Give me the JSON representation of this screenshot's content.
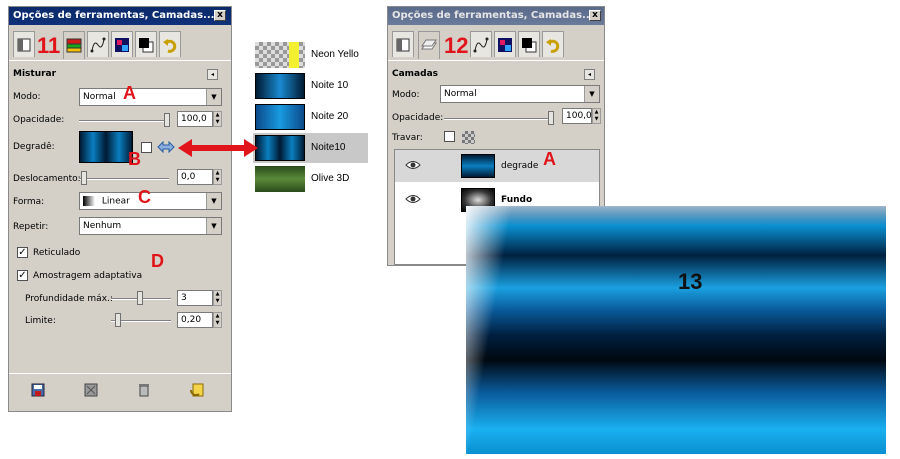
{
  "left_panel": {
    "title": "Opções de ferramentas, Camadas...",
    "close": "x",
    "tab_badge": "11",
    "section_title": "Misturar",
    "mode_label": "Modo:",
    "mode_value": "Normal",
    "opacity_label": "Opacidade:",
    "opacity_value": "100,0",
    "gradient_label": "Degradê:",
    "offset_label": "Deslocamento:",
    "offset_value": "0,0",
    "shape_label": "Forma:",
    "shape_value": "Linear",
    "repeat_label": "Repetir:",
    "repeat_value": "Nenhum",
    "dither_label": "Reticulado",
    "adaptive_label": "Amostragem adaptativa",
    "max_depth_label": "Profundidade máx.:",
    "max_depth_value": "3",
    "threshold_label": "Limite:",
    "threshold_value": "0,20",
    "marker_a": "A",
    "marker_b": "B",
    "marker_c": "C",
    "marker_d": "D"
  },
  "gradient_list": {
    "items": [
      {
        "name": "Neon Yello"
      },
      {
        "name": "Noite 10"
      },
      {
        "name": "Noite 20"
      },
      {
        "name": "Noite10"
      },
      {
        "name": "Olive 3D"
      }
    ]
  },
  "right_panel": {
    "title": "Opções de ferramentas, Camadas...",
    "close": "x",
    "tab_badge": "12",
    "section_title": "Camadas",
    "mode_label": "Modo:",
    "mode_value": "Normal",
    "opacity_label": "Opacidade:",
    "opacity_value": "100,0",
    "lock_label": "Travar:",
    "marker_a": "A",
    "layers": [
      {
        "name": "degrade"
      },
      {
        "name": "Fundo"
      }
    ]
  },
  "preview": {
    "number": "13"
  },
  "colors": {
    "accent_red": "#e0141a",
    "title_blue": "#0a2a6a",
    "panel_gray": "#d4d0c8"
  }
}
